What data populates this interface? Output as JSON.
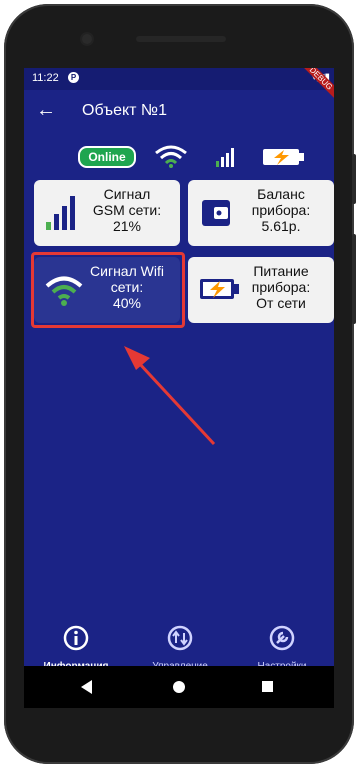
{
  "status_bar": {
    "time": "11:22",
    "notification_icon": "P",
    "right_icons": "▾◢▮",
    "debug_label": "DEBUG"
  },
  "app_bar": {
    "back_icon": "←",
    "title": "Объект №1"
  },
  "status_row": {
    "online_label": "Online"
  },
  "cards": {
    "gsm": {
      "line1": "Сигнал",
      "line2": "GSM сети:",
      "line3": "21%"
    },
    "balance": {
      "line1": "Баланс",
      "line2": "прибора:",
      "line3": "5.61р."
    },
    "wifi": {
      "line1": "Сигнал Wifi",
      "line2": "сети:",
      "line3": "40%"
    },
    "power": {
      "line1": "Питание",
      "line2": "прибора:",
      "line3": "От сети"
    }
  },
  "bottom_nav": [
    {
      "label": "Информация",
      "icon": "info-icon",
      "active": true
    },
    {
      "label": "Управление",
      "icon": "swap-icon",
      "active": false
    },
    {
      "label": "Настройки",
      "icon": "wrench-icon",
      "active": false
    }
  ],
  "colors": {
    "background": "#1b2386",
    "online": "#1fa54f",
    "highlight": "#e53935",
    "wifi_green": "#4caf50"
  }
}
